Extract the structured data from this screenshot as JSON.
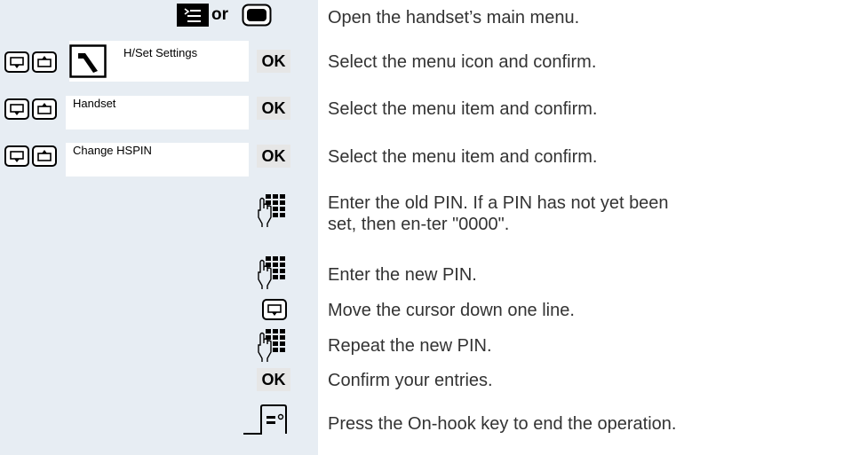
{
  "header": {
    "or_label": "or"
  },
  "menu": {
    "item1": "H/Set Settings",
    "item2": "Handset",
    "item3": "Change HSPIN"
  },
  "ok_label": "OK",
  "steps": [
    "Open the handset’s main menu.",
    "Select the menu icon and confirm.",
    "Select the menu item and confirm.",
    "Select the menu item and confirm.",
    "Enter the old PIN. If a PIN has not yet been set, then en-ter \"0000\".",
    "Enter the new PIN.",
    "Move the cursor down one line.",
    "Repeat the new PIN.",
    "Confirm your entries.",
    "Press the On-hook key to end the operation."
  ],
  "icons": {
    "menu_key": "menu-key-icon",
    "display_key": "display-key-icon",
    "nav_down": "nav-down-icon",
    "nav_up": "nav-up-icon",
    "settings": "wrench-icon",
    "keypad": "keypad-icon",
    "on_hook": "on-hook-icon"
  }
}
